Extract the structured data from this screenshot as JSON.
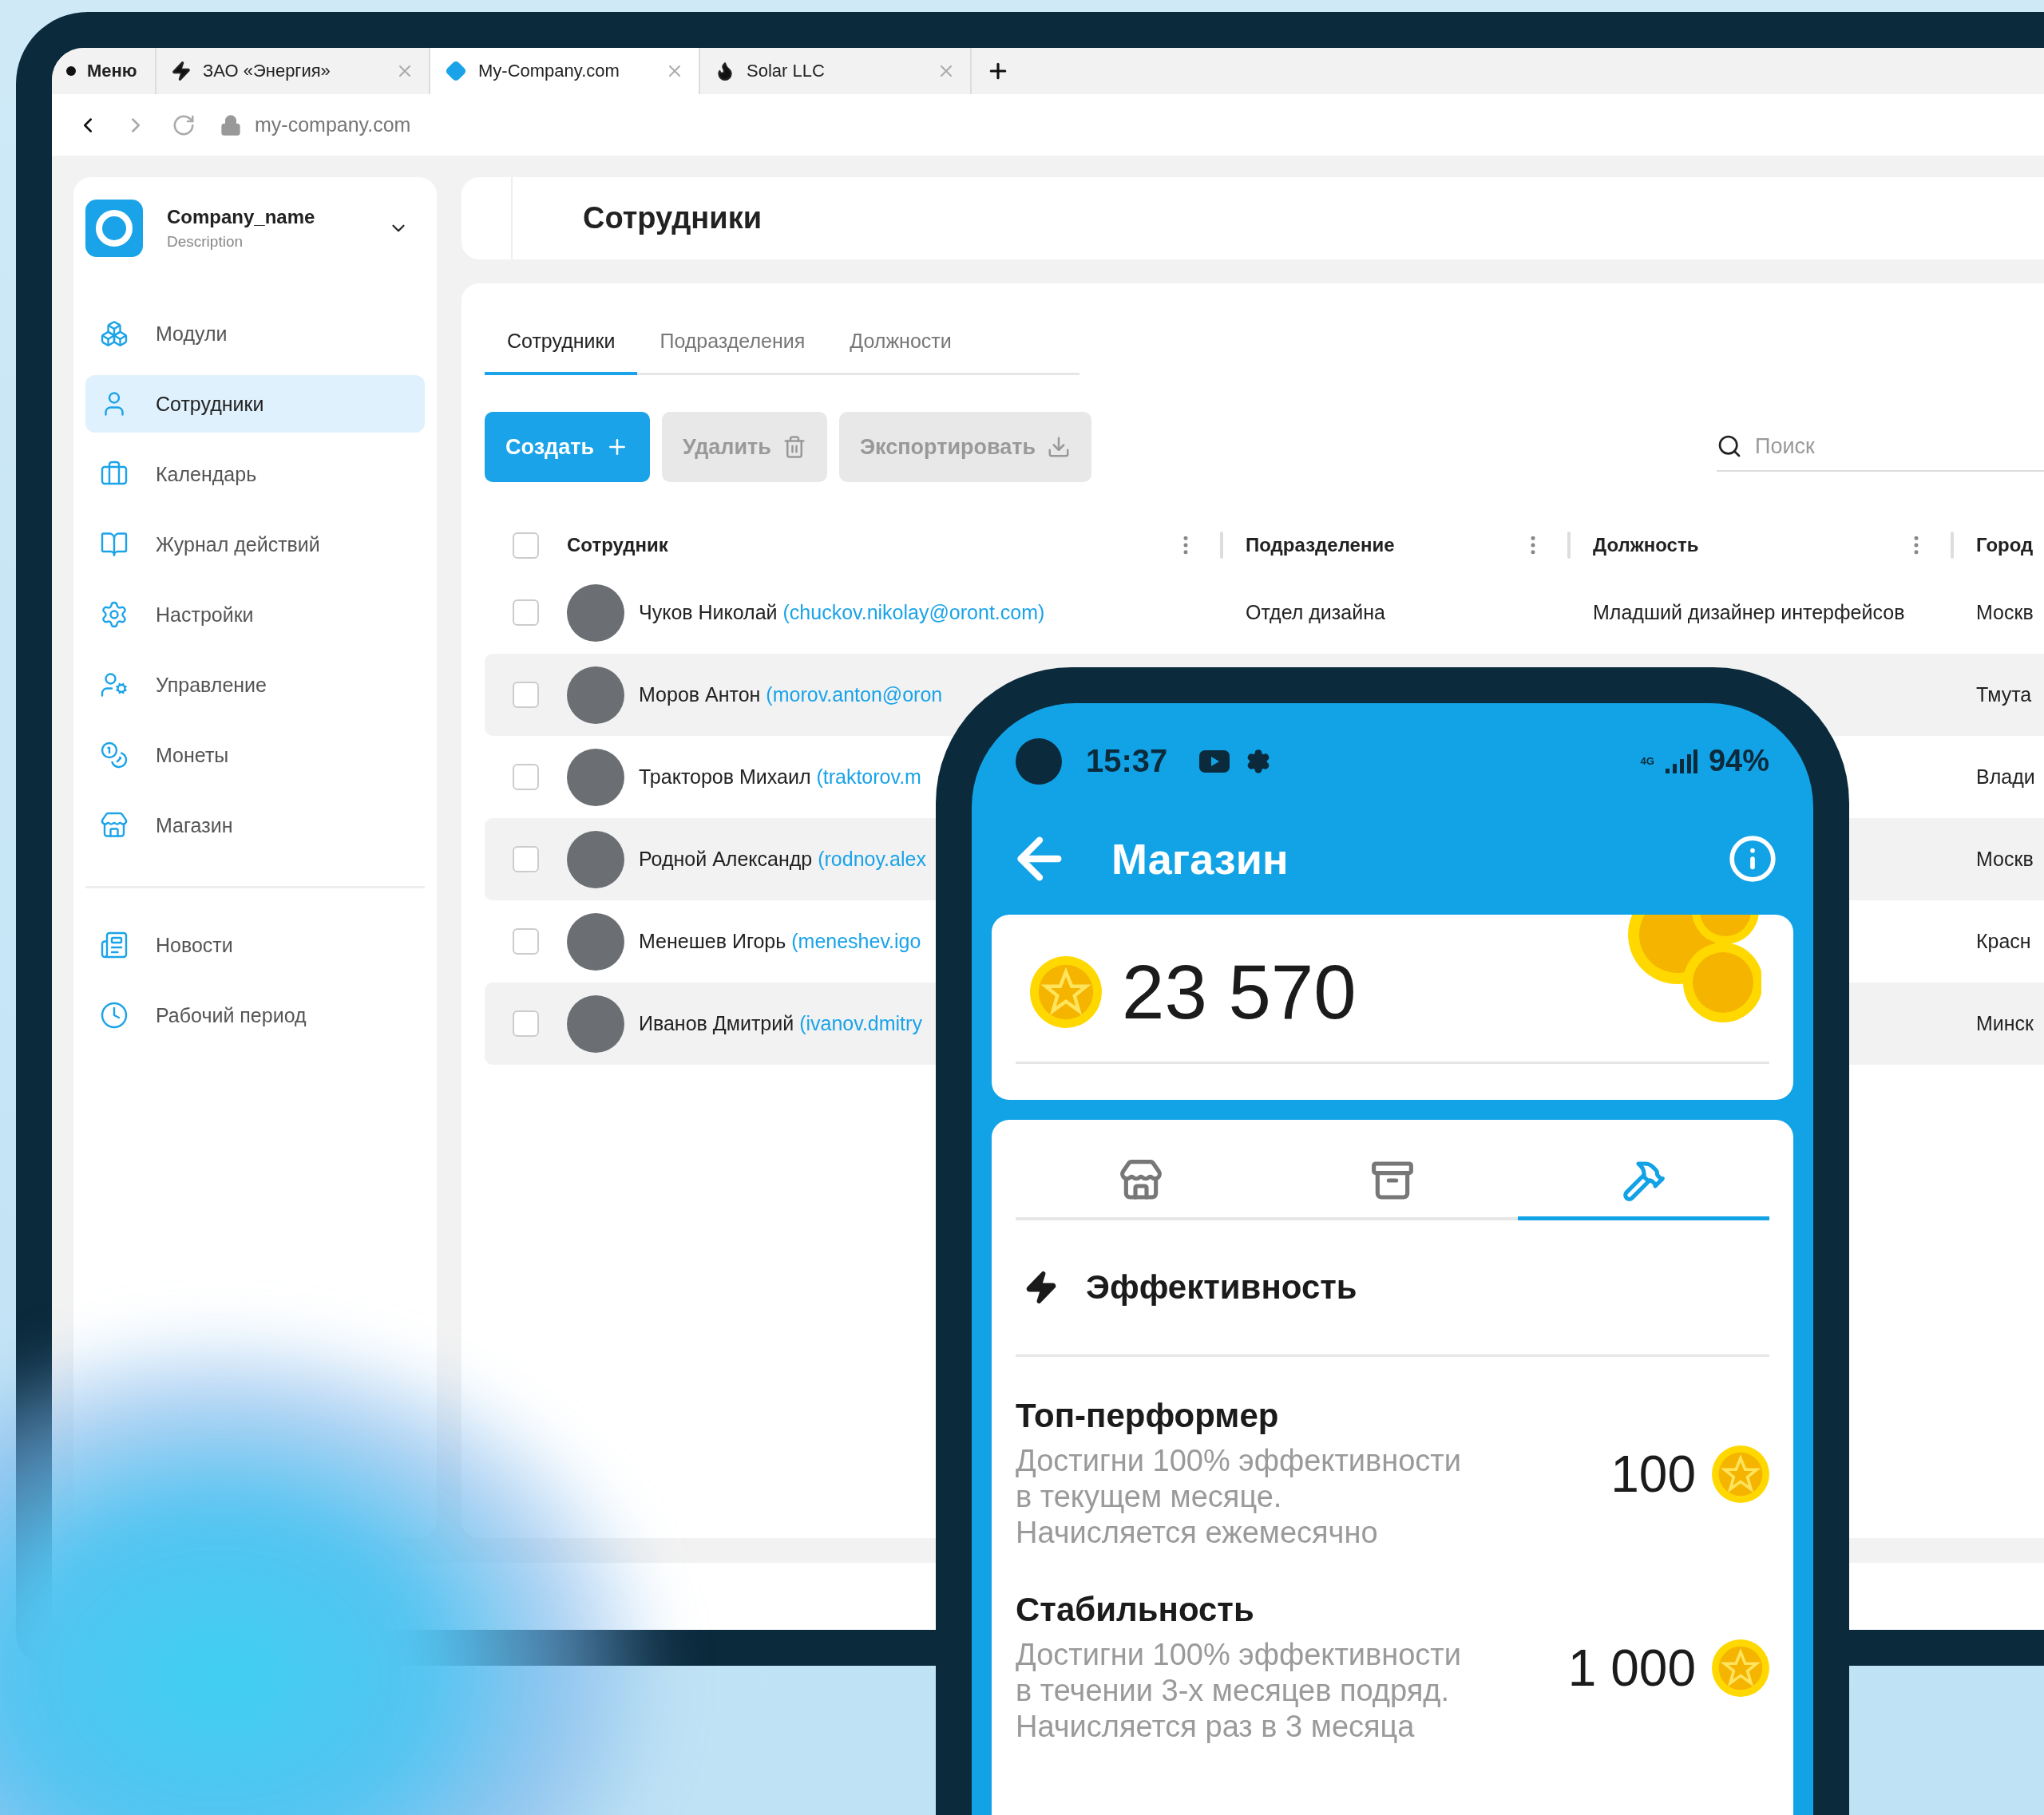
{
  "browser": {
    "tabs": [
      {
        "kind": "menu",
        "label": "Меню",
        "selected": false
      },
      {
        "kind": "bolt",
        "label": "ЗАО «Энергия»",
        "selected": false
      },
      {
        "kind": "diamond",
        "label": "My-Company.com",
        "selected": true
      },
      {
        "kind": "flame",
        "label": "Solar LLC",
        "selected": false
      }
    ],
    "url": "my-company.com"
  },
  "sidebar": {
    "company": {
      "name": "Company_name",
      "description": "Description"
    },
    "groups": [
      [
        {
          "label": "Модули",
          "selected": false
        },
        {
          "label": "Сотрудники",
          "selected": true
        },
        {
          "label": "Календарь",
          "selected": false
        },
        {
          "label": "Журнал действий",
          "selected": false
        },
        {
          "label": "Настройки",
          "selected": false
        },
        {
          "label": "Управление",
          "selected": false
        },
        {
          "label": "Монеты",
          "selected": false
        },
        {
          "label": "Магазин",
          "selected": false
        }
      ],
      [
        {
          "label": "Новости",
          "selected": false
        },
        {
          "label": "Рабочий период",
          "selected": false
        }
      ]
    ]
  },
  "page_title": "Сотрудники",
  "tabs": [
    {
      "label": "Сотрудники",
      "selected": true
    },
    {
      "label": "Подразделения",
      "selected": false
    },
    {
      "label": "Должности",
      "selected": false
    }
  ],
  "buttons": [
    {
      "kind": "primary",
      "label": "Создать"
    },
    {
      "kind": "secondary",
      "label": "Удалить"
    },
    {
      "kind": "secondary",
      "label": "Экспортировать"
    }
  ],
  "search": {
    "placeholder": "Поиск"
  },
  "table": {
    "header_checked": false,
    "columns": [
      "Сотрудник",
      "Подразделение",
      "Должность",
      "Город"
    ],
    "rows": [
      {
        "checked": false,
        "name": "Чуков Николай",
        "email": "(chuckov.nikolay@oront.com)",
        "department": "Отдел дизайна",
        "position": "Младший дизайнер интерфейсов",
        "city": "Москв"
      },
      {
        "checked": false,
        "name": "Моров Антон",
        "email": "(morov.anton@oron",
        "city": "Тмута"
      },
      {
        "checked": false,
        "name": "Тракторов Михаил",
        "email": "(traktorov.m",
        "city": "Влади"
      },
      {
        "checked": false,
        "name": "Родной Александр",
        "email": "(rodnoy.alex",
        "city": "Москв"
      },
      {
        "checked": false,
        "name": "Менешев Игорь",
        "email": "(meneshev.igo",
        "city": "Красн"
      },
      {
        "checked": false,
        "name": "Иванов Дмитрий",
        "email": "(ivanov.dmitry",
        "city": "Минск"
      }
    ]
  },
  "phone": {
    "status": {
      "time": "15:37",
      "network": "4G",
      "battery": "94%"
    },
    "title": "Магазин",
    "balance": "23 570",
    "tabs": [
      {
        "selected": false
      },
      {
        "selected": false
      },
      {
        "selected": true
      }
    ],
    "section_title": "Эффективность",
    "rewards": [
      {
        "title": "Топ-перформер",
        "description": "Достигни 100% эффективности\nв текущем месяце.\nНачисляется ежемесячно",
        "amount": "100"
      },
      {
        "title": "Стабильность",
        "description": "Достигни 100% эффективности\nв течении 3-х месяцев подряд.\nНачисляется раз в 3 месяца",
        "amount": "1 000"
      }
    ]
  }
}
